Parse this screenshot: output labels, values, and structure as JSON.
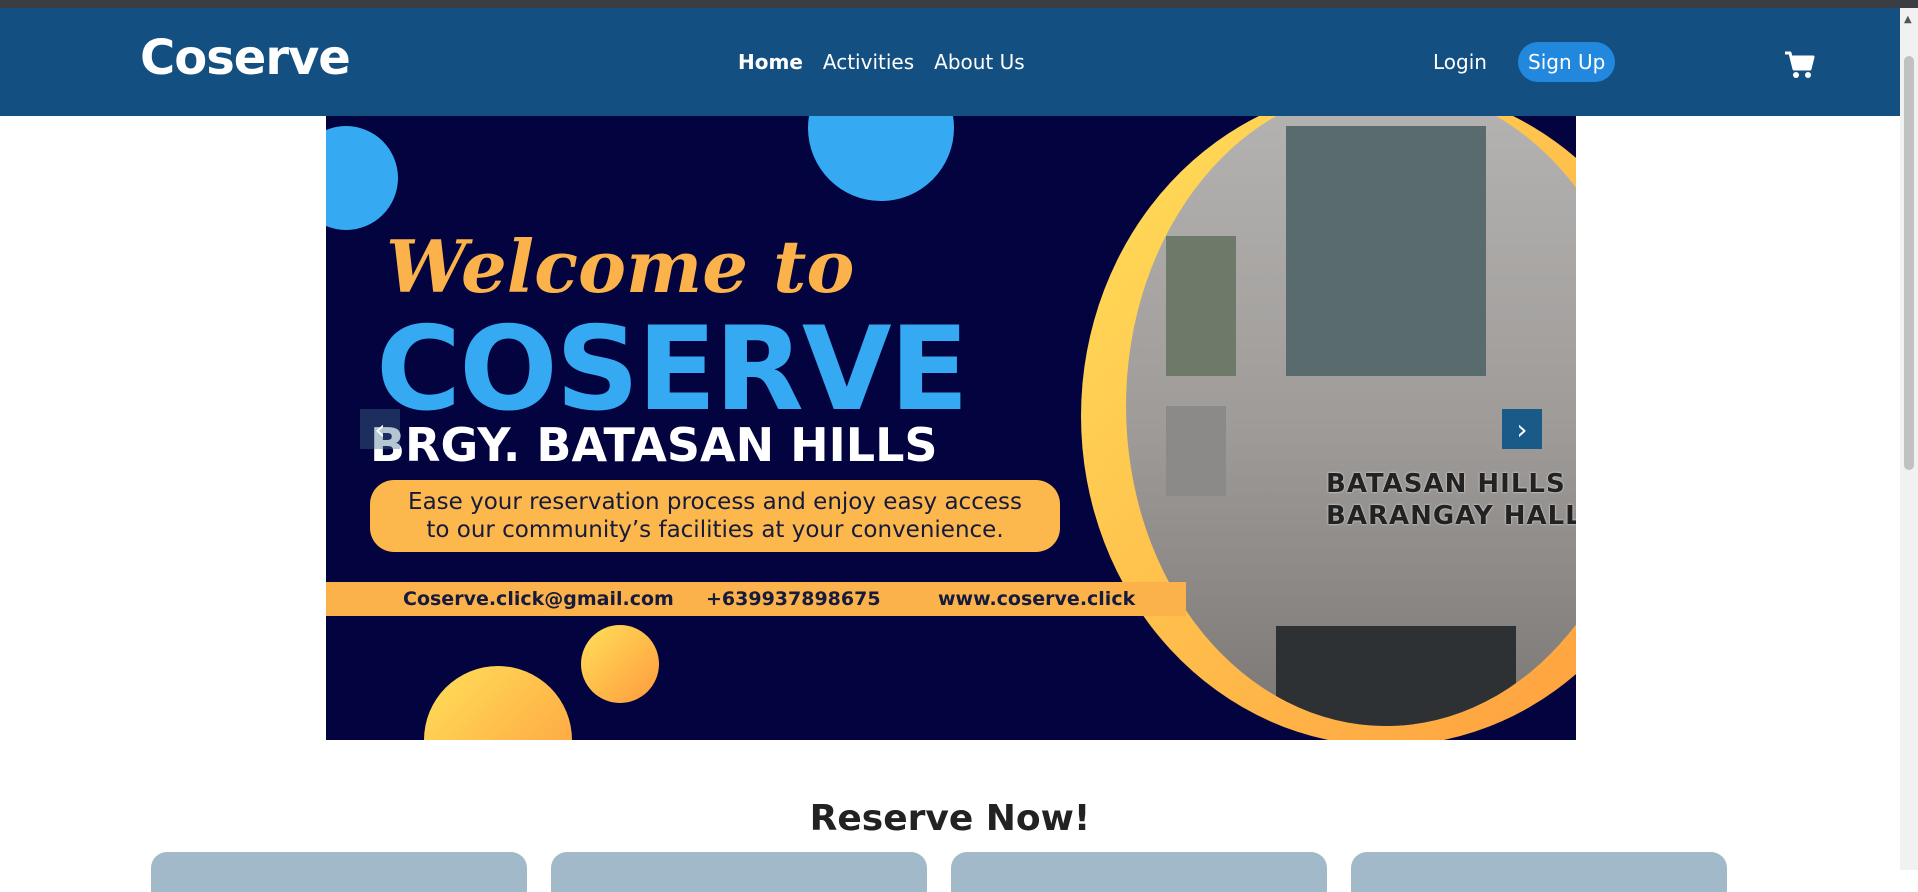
{
  "brand": "Coserve",
  "nav": {
    "home": "Home",
    "activities": "Activities",
    "about": "About Us"
  },
  "auth": {
    "login": "Login",
    "signup": "Sign Up"
  },
  "hero": {
    "welcome": "Welcome to",
    "title": "COSERVE",
    "subtitle": "BRGY. BATASAN HILLS",
    "tagline_line1": "Ease your reservation process and enjoy easy access",
    "tagline_line2": "to our community’s facilities at your convenience.",
    "email": "Coserve.click@gmail.com",
    "phone": "+639937898675",
    "website": "www.coserve.click",
    "sign_line1": "BATASAN HILLS",
    "sign_line2": "BARANGAY HALL"
  },
  "section": {
    "title": "Reserve Now!"
  },
  "colors": {
    "navbar": "#134f80",
    "accent": "#2288dd",
    "hero_bg": "#02033f",
    "hero_blue": "#35aaf2",
    "hero_orange": "#fbb24a"
  },
  "icons": {
    "cart": "cart-icon",
    "prev": "chevron-left-icon",
    "next": "chevron-right-icon"
  }
}
